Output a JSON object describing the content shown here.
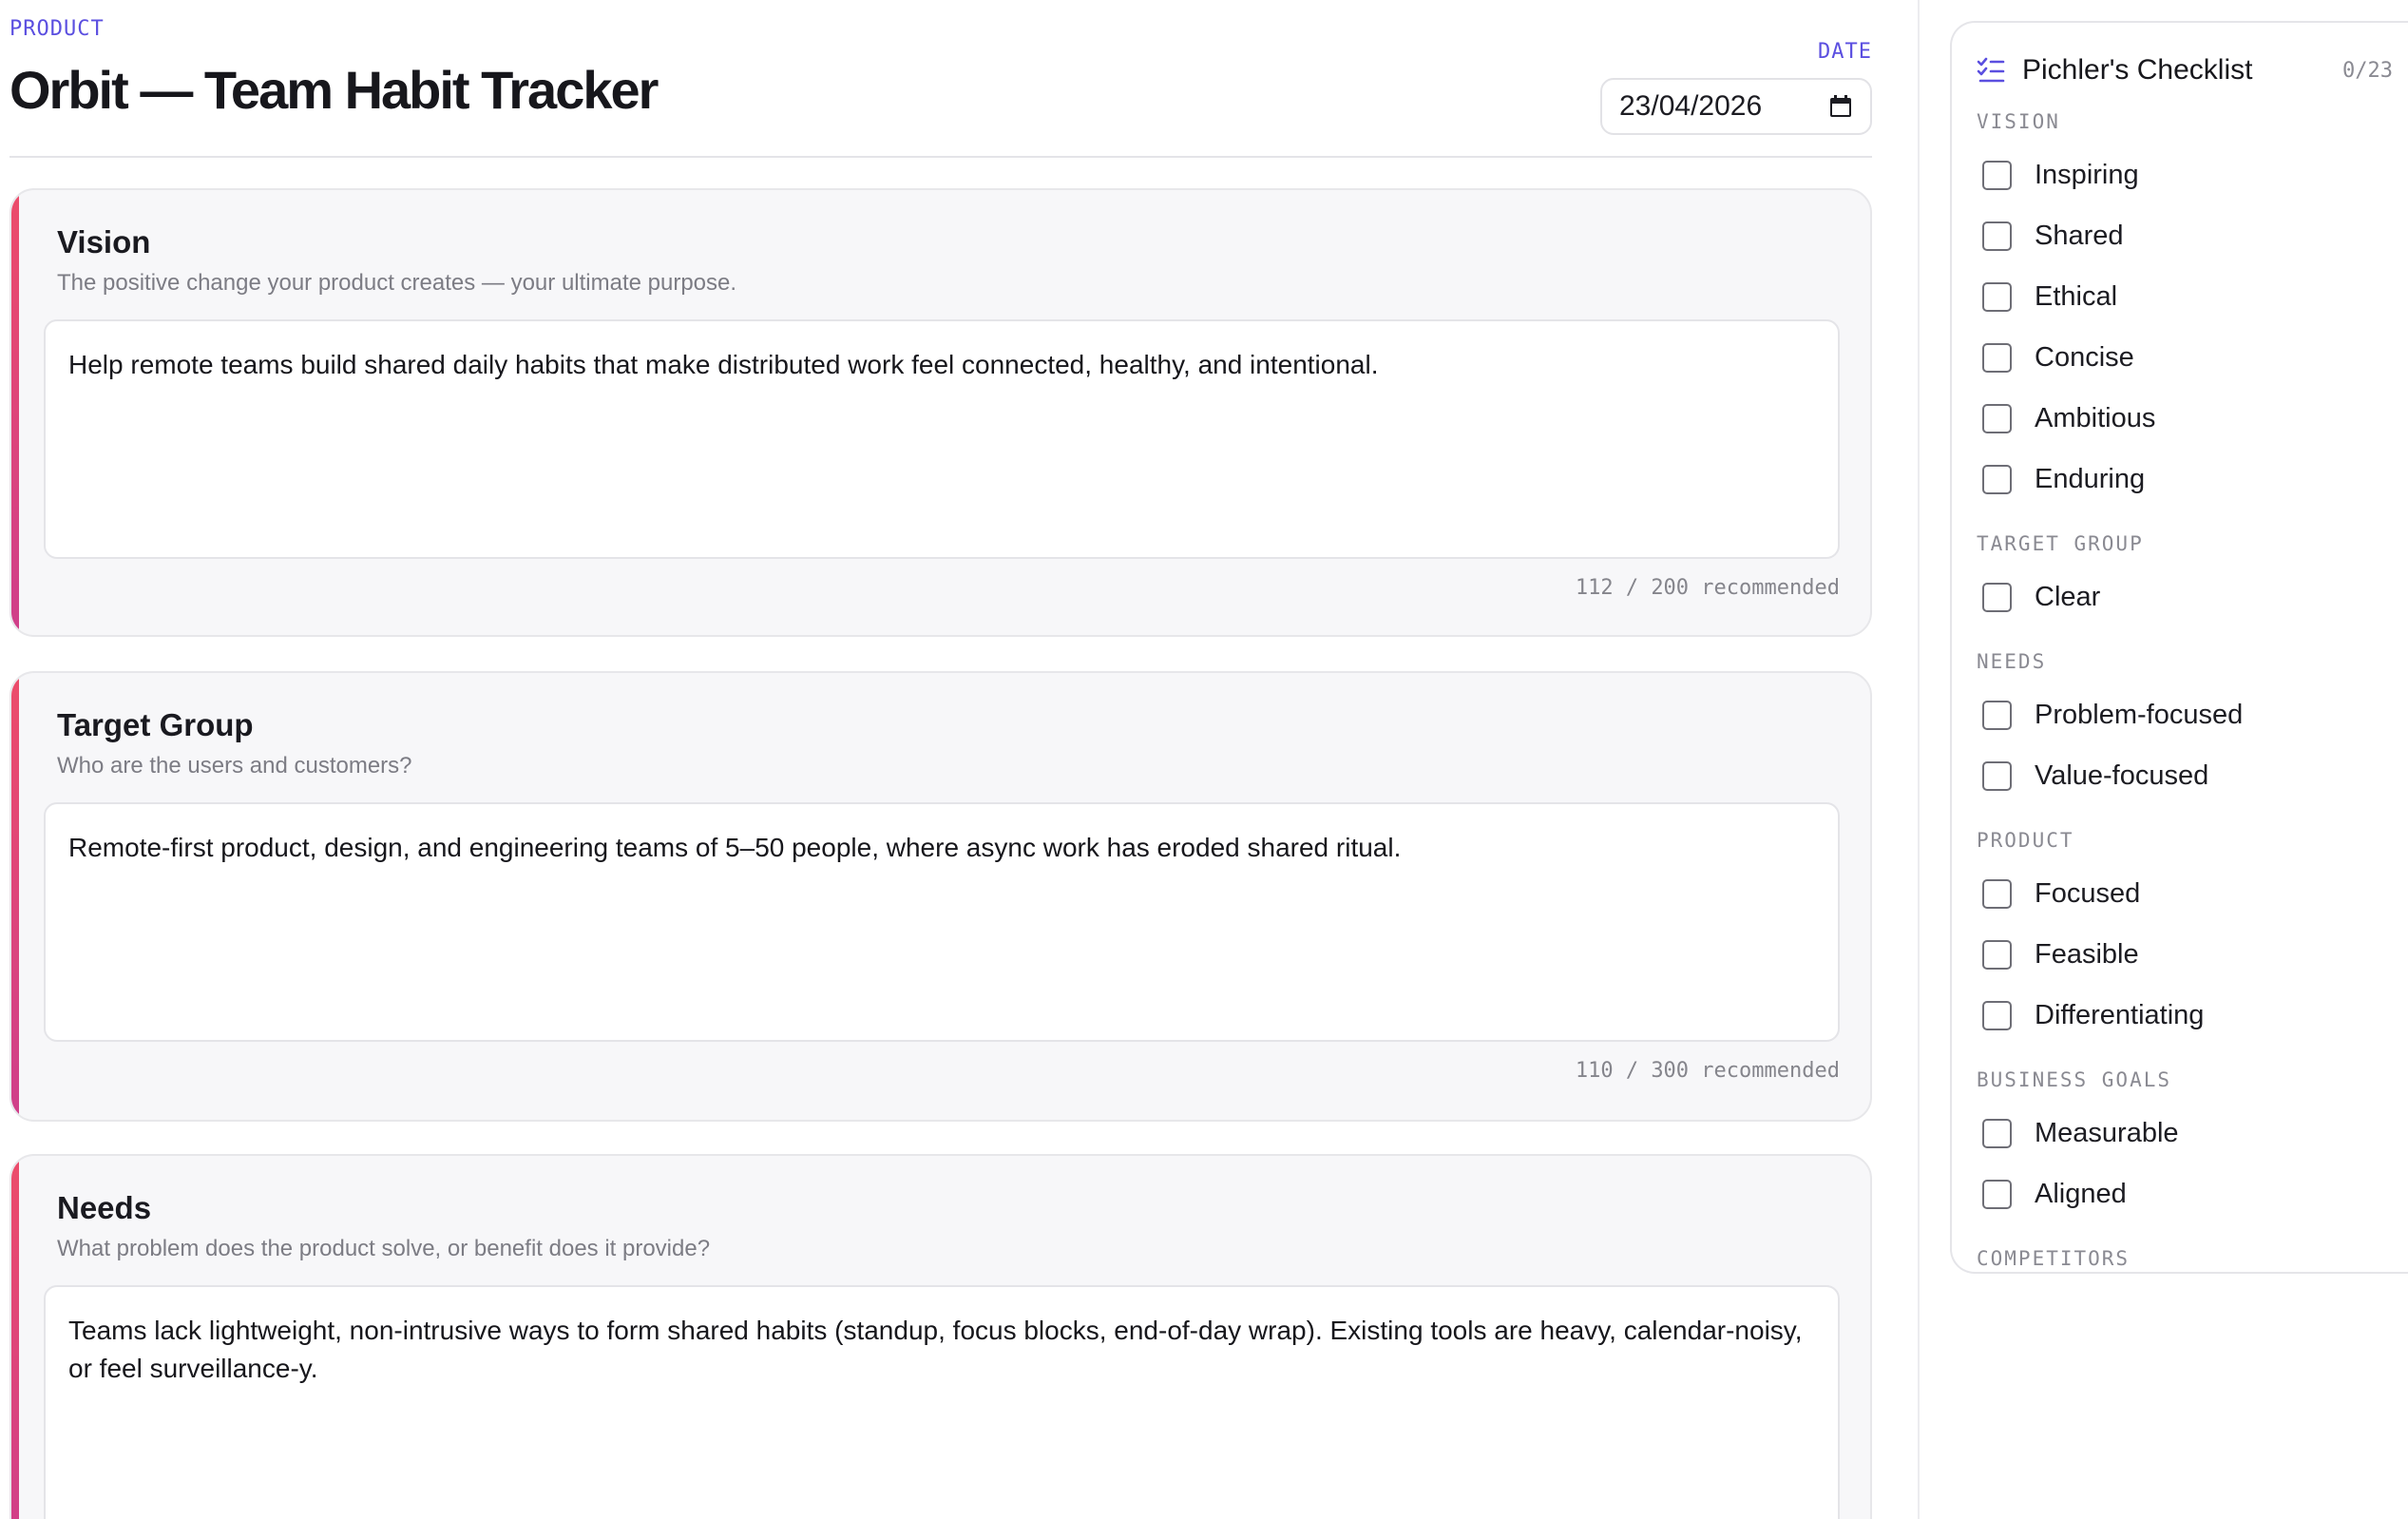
{
  "header": {
    "eyebrow": "PRODUCT",
    "title": "Orbit — Team Habit Tracker",
    "date_label": "DATE",
    "date_value": "23/04/2026"
  },
  "sections": [
    {
      "title": "Vision",
      "description": "The positive change your product creates — your ultimate purpose.",
      "text": "Help remote teams build shared daily habits that make distributed work feel connected, healthy, and intentional.",
      "counter": "112 / 200 recommended"
    },
    {
      "title": "Target Group",
      "description": "Who are the users and customers?",
      "text": "Remote-first product, design, and engineering teams of 5–50 people, where async work has eroded shared ritual.",
      "counter": "110 / 300 recommended"
    },
    {
      "title": "Needs",
      "description": "What problem does the product solve, or benefit does it provide?",
      "text": "Teams lack lightweight, non-intrusive ways to form shared habits (standup, focus blocks, end-of-day wrap). Existing tools are heavy, calendar-noisy, or feel surveillance-y.",
      "counter": ""
    }
  ],
  "checklist": {
    "title": "Pichler's Checklist",
    "count": "0/23",
    "groups": [
      {
        "label": "VISION",
        "items": [
          "Inspiring",
          "Shared",
          "Ethical",
          "Concise",
          "Ambitious",
          "Enduring"
        ]
      },
      {
        "label": "TARGET GROUP",
        "items": [
          "Clear"
        ]
      },
      {
        "label": "NEEDS",
        "items": [
          "Problem-focused",
          "Value-focused"
        ]
      },
      {
        "label": "PRODUCT",
        "items": [
          "Focused",
          "Feasible",
          "Differentiating"
        ]
      },
      {
        "label": "BUSINESS GOALS",
        "items": [
          "Measurable",
          "Aligned"
        ]
      },
      {
        "label": "COMPETITORS",
        "items": []
      }
    ]
  },
  "colors": {
    "accent": "#5b4fe0",
    "section_stripe_top": "#ec4c6a",
    "section_stripe_bottom": "#cf3f8a"
  },
  "icons": {
    "calendar": "calendar-icon",
    "checklist": "checklist-icon"
  }
}
